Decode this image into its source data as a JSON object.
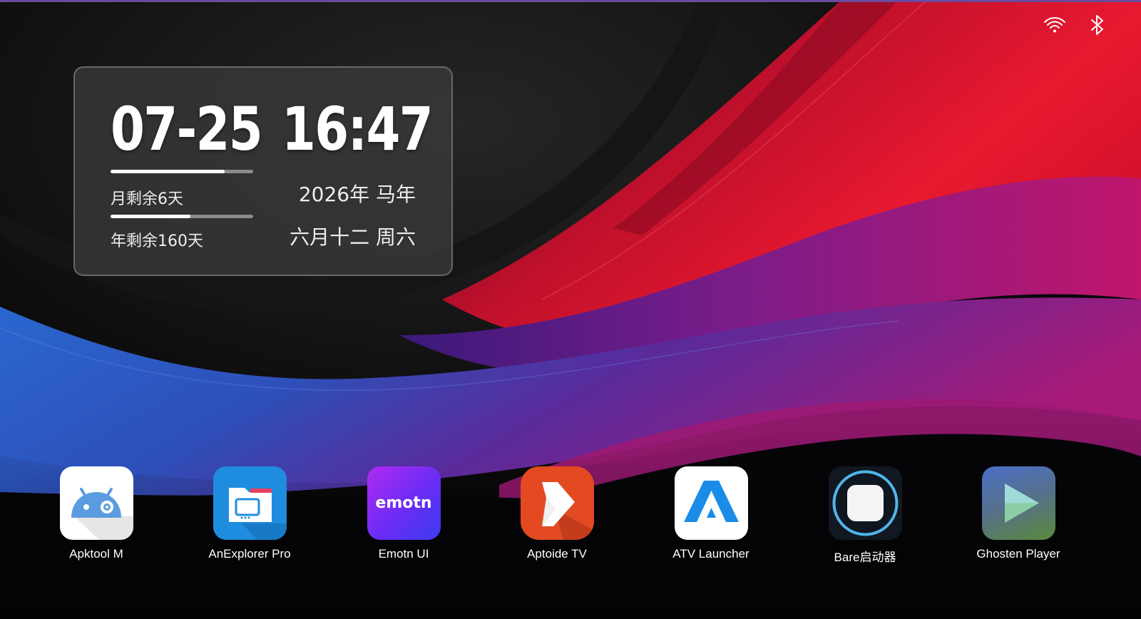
{
  "status_bar": {
    "icons": [
      "wifi-icon",
      "bluetooth-icon"
    ]
  },
  "clock_widget": {
    "date": "07-25",
    "time": "16:47",
    "month_remaining_label": "月剩余6天",
    "month_progress": 0.8,
    "year_remaining_label": "年剩余160天",
    "year_progress": 0.56,
    "year_zodiac": "2026年 马年",
    "lunar_date_weekday": "六月十二 周六"
  },
  "dock": {
    "apps": [
      {
        "label": "Apktool M",
        "icon": "android-gear-icon",
        "color": "#ffffff"
      },
      {
        "label": "AnExplorer Pro",
        "icon": "folder-tv-icon",
        "color": "#1e8de0"
      },
      {
        "label": "Emotn UI",
        "icon": "emotn-logo-icon",
        "icon_text": "emotn",
        "color": "#8b2cf0"
      },
      {
        "label": "Aptoide TV",
        "icon": "aptoide-arrow-icon",
        "color": "#e34a22"
      },
      {
        "label": "ATV Launcher",
        "icon": "atv-a-logo-icon",
        "color": "#ffffff"
      },
      {
        "label": "Bare启动器",
        "icon": "bare-square-icon",
        "color": "#1b2330"
      },
      {
        "label": "Ghosten Player",
        "icon": "play-triangle-icon",
        "color": "#4b6fb0"
      }
    ]
  },
  "colors": {
    "wallpaper_red": "#d8142e",
    "wallpaper_magenta": "#b0146e",
    "wallpaper_blue": "#2a5bc8",
    "widget_bg": "#3a3a3a"
  }
}
